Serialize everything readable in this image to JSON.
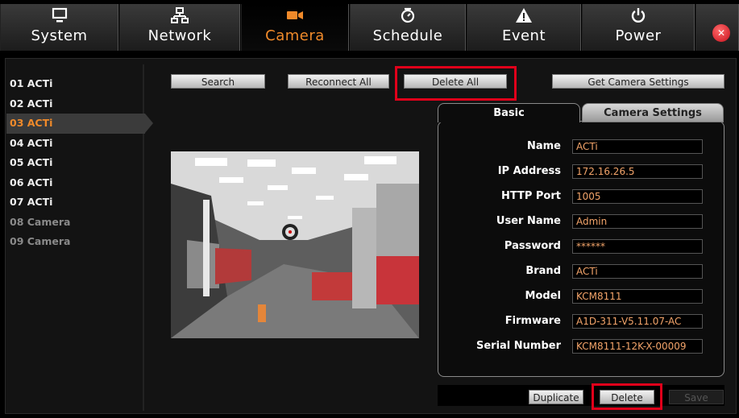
{
  "tabs": [
    {
      "label": "System",
      "icon": "monitor-icon"
    },
    {
      "label": "Network",
      "icon": "network-icon"
    },
    {
      "label": "Camera",
      "icon": "camera-icon",
      "active": true
    },
    {
      "label": "Schedule",
      "icon": "clock-icon"
    },
    {
      "label": "Event",
      "icon": "warning-icon"
    },
    {
      "label": "Power",
      "icon": "power-icon"
    }
  ],
  "cameras": [
    "01 ACTi",
    "02 ACTi",
    "03 ACTi",
    "04 ACTi",
    "05 ACTi",
    "06 ACTi",
    "07 ACTi",
    "08 Camera",
    "09 Camera"
  ],
  "selected_camera": "03 ACTi",
  "toolbar": {
    "search": "Search",
    "reconnect_all": "Reconnect All",
    "delete_all": "Delete All",
    "get_camera_settings": "Get Camera Settings"
  },
  "settings_tabs": {
    "basic": "Basic",
    "camera_settings": "Camera Settings"
  },
  "fields": {
    "name": {
      "label": "Name",
      "value": "ACTi"
    },
    "ip": {
      "label": "IP Address",
      "value": "172.16.26.5"
    },
    "http_port": {
      "label": "HTTP Port",
      "value": "1005"
    },
    "user": {
      "label": "User Name",
      "value": "Admin"
    },
    "password": {
      "label": "Password",
      "value": "******"
    },
    "brand": {
      "label": "Brand",
      "value": "ACTi"
    },
    "model": {
      "label": "Model",
      "value": "KCM8111"
    },
    "firmware": {
      "label": "Firmware",
      "value": "A1D-311-V5.11.07-AC"
    },
    "serial": {
      "label": "Serial Number",
      "value": "KCM8111-12K-X-00009"
    }
  },
  "actions": {
    "duplicate": "Duplicate",
    "delete": "Delete",
    "save": "Save"
  },
  "colors": {
    "accent": "#f08a2a",
    "highlight": "#e0001a",
    "value_text": "#f3a46a"
  }
}
